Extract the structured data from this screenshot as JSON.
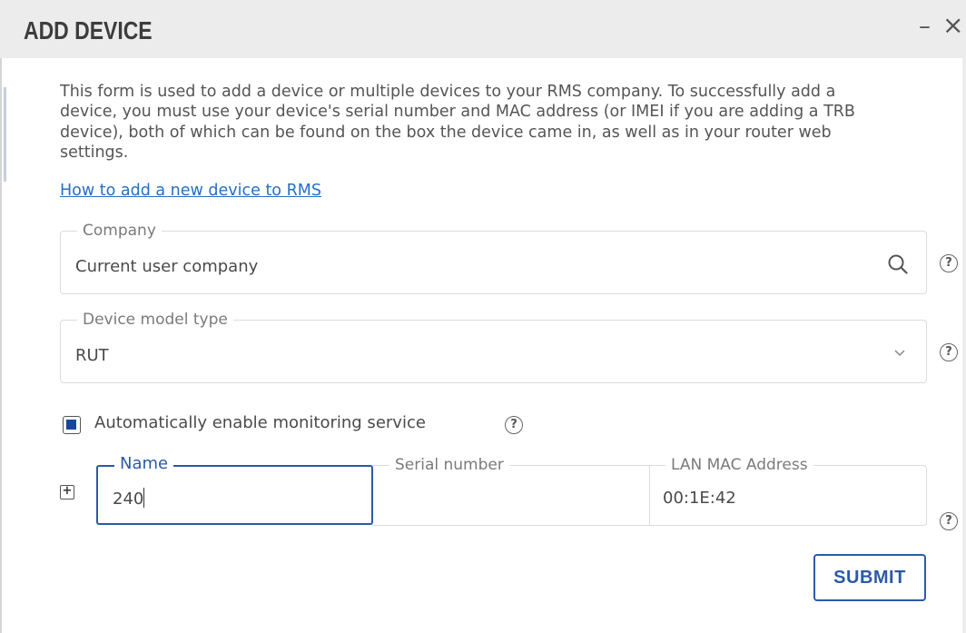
{
  "dialog": {
    "title": "ADD DEVICE",
    "minimize_glyph": "–",
    "close_glyph": "×"
  },
  "description": "This form is used to add a device or multiple devices to your RMS company. To successfully add a device, you must use your device's serial number and MAC address (or IMEI if you are adding a TRB device), both of which can be found on the box the device came in, as well as in your router web settings.",
  "help_link": "How to add a new device to RMS",
  "company": {
    "label": "Company",
    "value": "Current user company",
    "icon": "search-icon"
  },
  "device_model": {
    "label": "Device model type",
    "value": "RUT",
    "icon": "chevron-down-icon"
  },
  "monitoring": {
    "label": "Automatically enable monitoring service",
    "checked": true
  },
  "device_row": {
    "name_label": "Name",
    "name_value": "240",
    "serial_label": "Serial number",
    "serial_value": "",
    "mac_label": "LAN MAC Address",
    "mac_value": "00:1E:42",
    "add_glyph": "+"
  },
  "help_glyph": "?",
  "submit_label": "SUBMIT",
  "colors": {
    "accent": "#2b5aa8",
    "link": "#2470c6",
    "checkbox_fill": "#17479a",
    "header_bg": "#ececec"
  }
}
